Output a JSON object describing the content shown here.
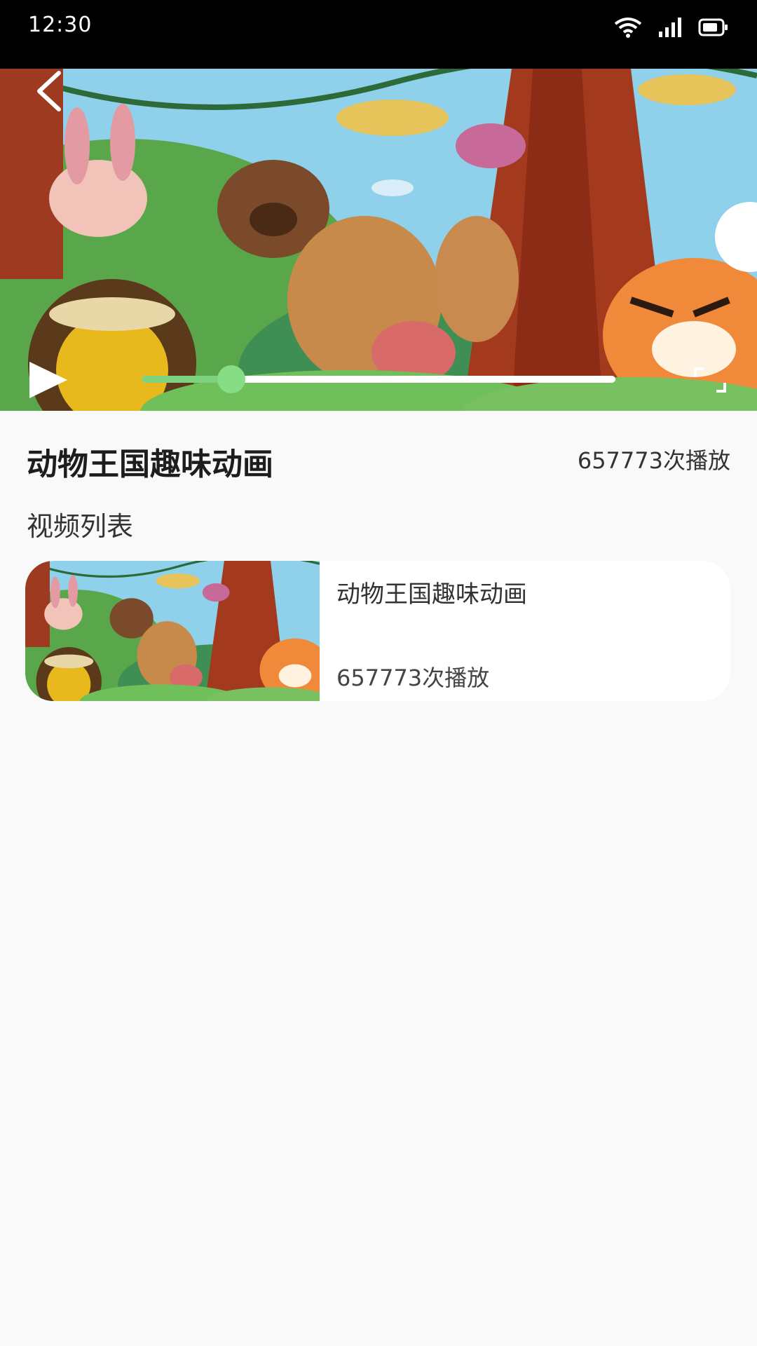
{
  "status_bar": {
    "time": "12:30",
    "icons": [
      "wifi-icon",
      "signal-icon",
      "battery-icon"
    ]
  },
  "player": {
    "progress": 0.19,
    "colors": {
      "progress_fill": "#7dd27d",
      "thumb": "#86dd86",
      "track": "#ffffff"
    },
    "icons": [
      "back-icon",
      "play-icon",
      "fullscreen-icon"
    ]
  },
  "video": {
    "title": "动物王国趣味动画",
    "play_count": "657773次播放"
  },
  "list": {
    "section_title": "视频列表",
    "items": [
      {
        "title": "动物王国趣味动画",
        "play_count": "657773次播放"
      }
    ]
  }
}
